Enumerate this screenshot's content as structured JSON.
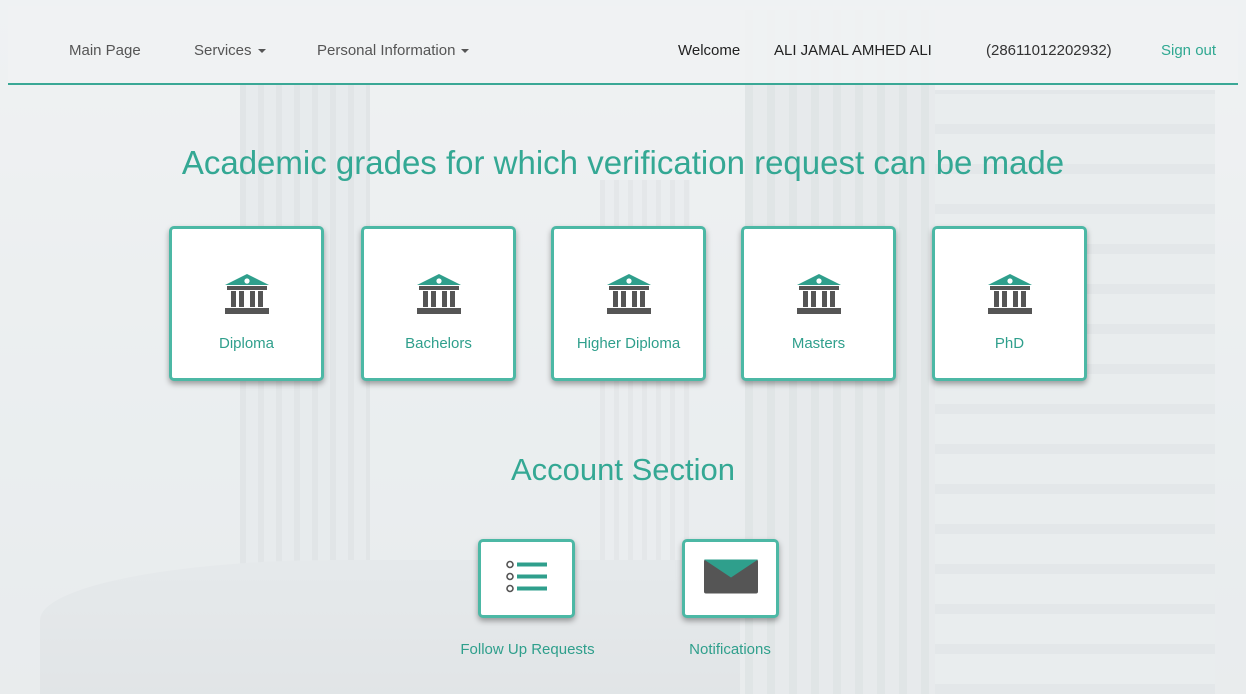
{
  "nav": {
    "main_page": "Main Page",
    "services": "Services",
    "personal_information": "Personal Information",
    "welcome": "Welcome",
    "user_name": "ALI JAMAL AMHED ALI",
    "user_id": "(28611012202932)",
    "sign_out": "Sign out"
  },
  "grades": {
    "title": "Academic grades for which verification request can be made",
    "items": [
      {
        "label": "Diploma",
        "icon": "institution-icon"
      },
      {
        "label": "Bachelors",
        "icon": "institution-icon"
      },
      {
        "label": "Higher Diploma",
        "icon": "institution-icon"
      },
      {
        "label": "Masters",
        "icon": "institution-icon"
      },
      {
        "label": "PhD",
        "icon": "institution-icon"
      }
    ]
  },
  "account": {
    "title": "Account Section",
    "items": [
      {
        "label": "Follow Up Requests",
        "icon": "list-icon"
      },
      {
        "label": "Notifications",
        "icon": "envelope-icon"
      }
    ]
  },
  "colors": {
    "accent": "#34a894",
    "icon_gray": "#555555"
  }
}
